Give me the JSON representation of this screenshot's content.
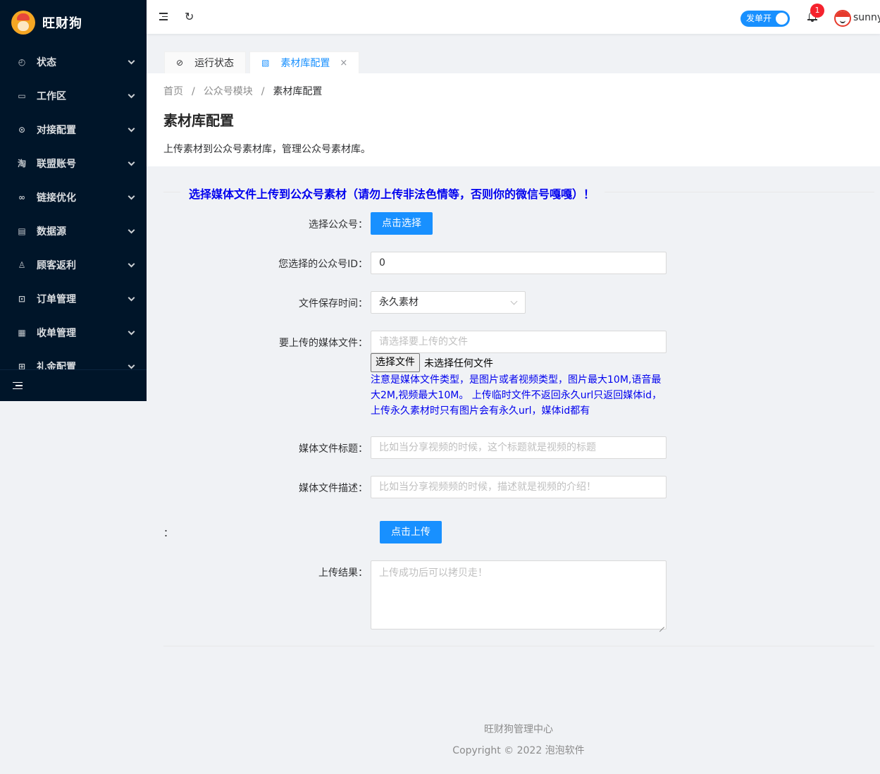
{
  "brand": {
    "name": "旺财狗"
  },
  "sidebar": {
    "items": [
      {
        "label": "状态",
        "icon": "dashboard-icon"
      },
      {
        "label": "工作区",
        "icon": "desktop-icon"
      },
      {
        "label": "对接配置",
        "icon": "api-icon"
      },
      {
        "label": "联盟账号",
        "icon": "taobao-icon"
      },
      {
        "label": "链接优化",
        "icon": "link-icon"
      },
      {
        "label": "数据源",
        "icon": "database-icon"
      },
      {
        "label": "顾客返利",
        "icon": "user-icon"
      },
      {
        "label": "订单管理",
        "icon": "order-icon"
      },
      {
        "label": "收单管理",
        "icon": "receipt-icon"
      },
      {
        "label": "礼金配置",
        "icon": "gift-icon"
      }
    ]
  },
  "header": {
    "switch_label": "发单开",
    "notification_count": "1",
    "username": "sunny"
  },
  "tabs": [
    {
      "label": "运行状态",
      "icon": "clock-check-icon",
      "active": false
    },
    {
      "label": "素材库配置",
      "icon": "image-icon",
      "active": true,
      "close": "×"
    }
  ],
  "breadcrumb": [
    "首页",
    "公众号模块",
    "素材库配置"
  ],
  "breadcrumb_sep": "/",
  "page": {
    "title": "素材库配置",
    "description": "上传素材到公众号素材库，管理公众号素材库。"
  },
  "form": {
    "section_title": "选择媒体文件上传到公众号素材（请勿上传非法色情等，否则你的微信号嘎嘎）！",
    "account": {
      "label": "选择公众号：",
      "button": "点击选择"
    },
    "account_id": {
      "label": "您选择的公众号ID：",
      "value": "0"
    },
    "save_time": {
      "label": "文件保存时间：",
      "value": "永久素材"
    },
    "media_file": {
      "label": "要上传的媒体文件：",
      "placeholder": "请选择要上传的文件",
      "file_button": "选择文件",
      "file_status": "未选择任何文件",
      "hint": "注意是媒体文件类型，是图片或者视频类型，图片最大10M,语音最大2M,视频最大10M。 上传临时文件不返回永久url只返回媒体id，上传永久素材时只有图片会有永久url，媒体id都有"
    },
    "media_title": {
      "label": "媒体文件标题：",
      "placeholder": "比如当分享视频的时候，这个标题就是视频的标题"
    },
    "media_desc": {
      "label": "媒体文件描述：",
      "placeholder": "比如当分享视频频的时候，描述就是视频的介绍！"
    },
    "upload": {
      "label": "：",
      "button": "点击上传"
    },
    "result": {
      "label": "上传结果：",
      "placeholder": "上传成功后可以拷贝走！"
    }
  },
  "footer": {
    "line1": "旺财狗管理中心",
    "line2": "Copyright © 2022 泡泡软件"
  },
  "colors": {
    "sidebar_bg": "#001529",
    "primary": "#1890ff",
    "notice_text": "#0000ee",
    "badge": "#f5222d"
  }
}
